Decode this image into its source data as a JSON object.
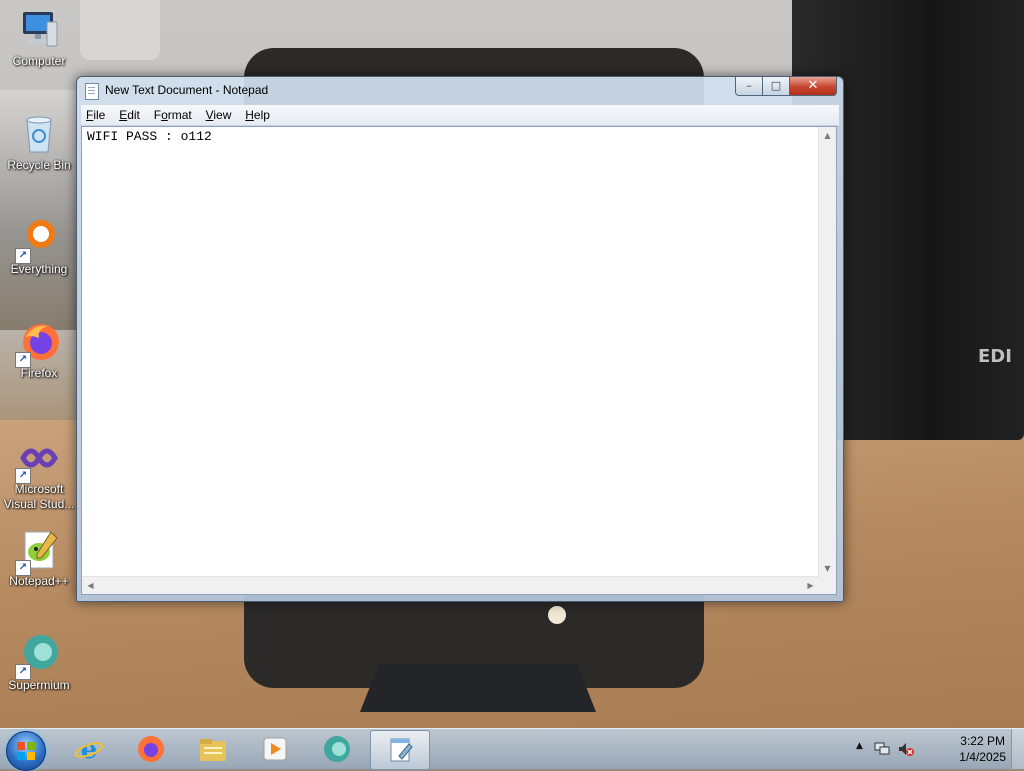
{
  "desktop": {
    "wallpaper_text": "EDI",
    "icons": [
      {
        "label": "Computer"
      },
      {
        "label": "Recycle Bin"
      },
      {
        "label": "Everything"
      },
      {
        "label": "Firefox"
      },
      {
        "label": "Microsoft Visual Stud..."
      },
      {
        "label": "Notepad++"
      },
      {
        "label": "Supermium"
      }
    ]
  },
  "window": {
    "title": "New Text Document - Notepad",
    "buttons": {
      "minimize": "–",
      "maximize": "□",
      "close": "✕"
    },
    "menu": [
      {
        "key": "F",
        "rest": "ile"
      },
      {
        "key": "E",
        "rest": "dit"
      },
      {
        "key": "F",
        "rest": "ormat",
        "key_after": "o"
      },
      {
        "key": "V",
        "rest": "iew"
      },
      {
        "key": "H",
        "rest": "elp"
      }
    ],
    "content": "WIFI PASS : o112"
  },
  "taskbar": {
    "pinned": [
      "internet-explorer-icon",
      "firefox-icon",
      "file-explorer-icon",
      "media-player-icon",
      "supermium-icon",
      "notepad-icon"
    ],
    "clock_time": "3:22 PM",
    "clock_date": "1/4/2025"
  },
  "colors": {
    "close_red": "#c84630",
    "accent_blue": "#2b6fc5"
  }
}
